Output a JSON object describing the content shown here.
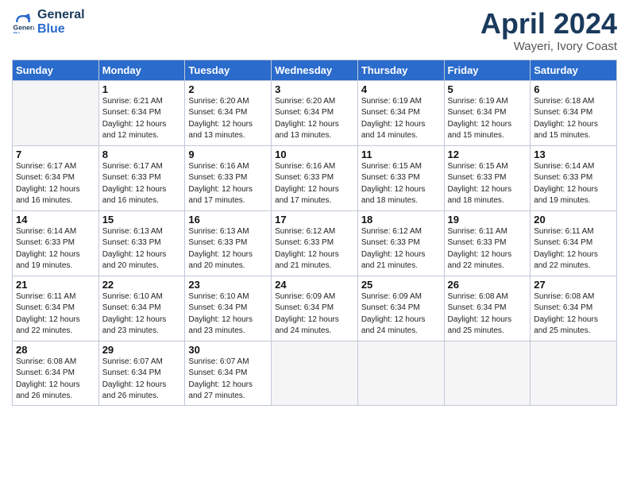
{
  "logo": {
    "line1": "General",
    "line2": "Blue"
  },
  "title": "April 2024",
  "subtitle": "Wayeri, Ivory Coast",
  "header_days": [
    "Sunday",
    "Monday",
    "Tuesday",
    "Wednesday",
    "Thursday",
    "Friday",
    "Saturday"
  ],
  "weeks": [
    [
      {
        "day": "",
        "info": ""
      },
      {
        "day": "1",
        "info": "Sunrise: 6:21 AM\nSunset: 6:34 PM\nDaylight: 12 hours\nand 12 minutes."
      },
      {
        "day": "2",
        "info": "Sunrise: 6:20 AM\nSunset: 6:34 PM\nDaylight: 12 hours\nand 13 minutes."
      },
      {
        "day": "3",
        "info": "Sunrise: 6:20 AM\nSunset: 6:34 PM\nDaylight: 12 hours\nand 13 minutes."
      },
      {
        "day": "4",
        "info": "Sunrise: 6:19 AM\nSunset: 6:34 PM\nDaylight: 12 hours\nand 14 minutes."
      },
      {
        "day": "5",
        "info": "Sunrise: 6:19 AM\nSunset: 6:34 PM\nDaylight: 12 hours\nand 15 minutes."
      },
      {
        "day": "6",
        "info": "Sunrise: 6:18 AM\nSunset: 6:34 PM\nDaylight: 12 hours\nand 15 minutes."
      }
    ],
    [
      {
        "day": "7",
        "info": "Sunrise: 6:17 AM\nSunset: 6:34 PM\nDaylight: 12 hours\nand 16 minutes."
      },
      {
        "day": "8",
        "info": "Sunrise: 6:17 AM\nSunset: 6:33 PM\nDaylight: 12 hours\nand 16 minutes."
      },
      {
        "day": "9",
        "info": "Sunrise: 6:16 AM\nSunset: 6:33 PM\nDaylight: 12 hours\nand 17 minutes."
      },
      {
        "day": "10",
        "info": "Sunrise: 6:16 AM\nSunset: 6:33 PM\nDaylight: 12 hours\nand 17 minutes."
      },
      {
        "day": "11",
        "info": "Sunrise: 6:15 AM\nSunset: 6:33 PM\nDaylight: 12 hours\nand 18 minutes."
      },
      {
        "day": "12",
        "info": "Sunrise: 6:15 AM\nSunset: 6:33 PM\nDaylight: 12 hours\nand 18 minutes."
      },
      {
        "day": "13",
        "info": "Sunrise: 6:14 AM\nSunset: 6:33 PM\nDaylight: 12 hours\nand 19 minutes."
      }
    ],
    [
      {
        "day": "14",
        "info": "Sunrise: 6:14 AM\nSunset: 6:33 PM\nDaylight: 12 hours\nand 19 minutes."
      },
      {
        "day": "15",
        "info": "Sunrise: 6:13 AM\nSunset: 6:33 PM\nDaylight: 12 hours\nand 20 minutes."
      },
      {
        "day": "16",
        "info": "Sunrise: 6:13 AM\nSunset: 6:33 PM\nDaylight: 12 hours\nand 20 minutes."
      },
      {
        "day": "17",
        "info": "Sunrise: 6:12 AM\nSunset: 6:33 PM\nDaylight: 12 hours\nand 21 minutes."
      },
      {
        "day": "18",
        "info": "Sunrise: 6:12 AM\nSunset: 6:33 PM\nDaylight: 12 hours\nand 21 minutes."
      },
      {
        "day": "19",
        "info": "Sunrise: 6:11 AM\nSunset: 6:33 PM\nDaylight: 12 hours\nand 22 minutes."
      },
      {
        "day": "20",
        "info": "Sunrise: 6:11 AM\nSunset: 6:34 PM\nDaylight: 12 hours\nand 22 minutes."
      }
    ],
    [
      {
        "day": "21",
        "info": "Sunrise: 6:11 AM\nSunset: 6:34 PM\nDaylight: 12 hours\nand 22 minutes."
      },
      {
        "day": "22",
        "info": "Sunrise: 6:10 AM\nSunset: 6:34 PM\nDaylight: 12 hours\nand 23 minutes."
      },
      {
        "day": "23",
        "info": "Sunrise: 6:10 AM\nSunset: 6:34 PM\nDaylight: 12 hours\nand 23 minutes."
      },
      {
        "day": "24",
        "info": "Sunrise: 6:09 AM\nSunset: 6:34 PM\nDaylight: 12 hours\nand 24 minutes."
      },
      {
        "day": "25",
        "info": "Sunrise: 6:09 AM\nSunset: 6:34 PM\nDaylight: 12 hours\nand 24 minutes."
      },
      {
        "day": "26",
        "info": "Sunrise: 6:08 AM\nSunset: 6:34 PM\nDaylight: 12 hours\nand 25 minutes."
      },
      {
        "day": "27",
        "info": "Sunrise: 6:08 AM\nSunset: 6:34 PM\nDaylight: 12 hours\nand 25 minutes."
      }
    ],
    [
      {
        "day": "28",
        "info": "Sunrise: 6:08 AM\nSunset: 6:34 PM\nDaylight: 12 hours\nand 26 minutes."
      },
      {
        "day": "29",
        "info": "Sunrise: 6:07 AM\nSunset: 6:34 PM\nDaylight: 12 hours\nand 26 minutes."
      },
      {
        "day": "30",
        "info": "Sunrise: 6:07 AM\nSunset: 6:34 PM\nDaylight: 12 hours\nand 27 minutes."
      },
      {
        "day": "",
        "info": ""
      },
      {
        "day": "",
        "info": ""
      },
      {
        "day": "",
        "info": ""
      },
      {
        "day": "",
        "info": ""
      }
    ]
  ]
}
